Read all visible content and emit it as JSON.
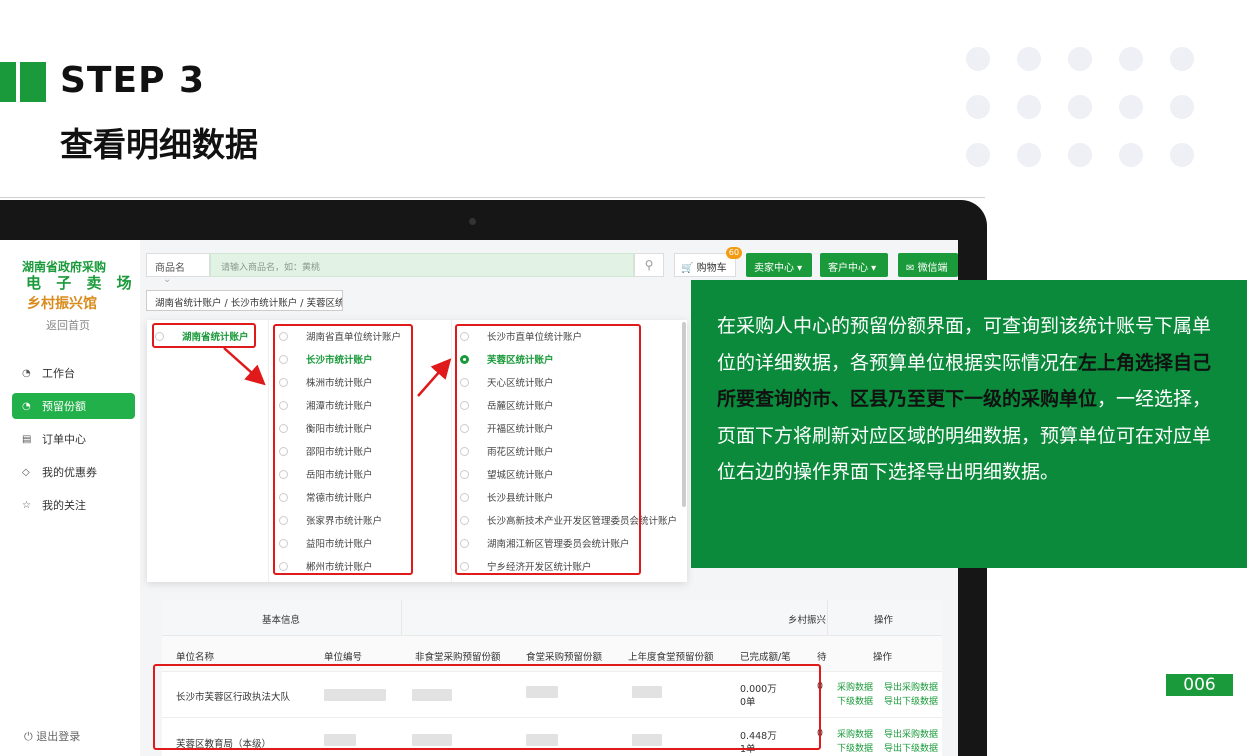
{
  "header": {
    "step": "STEP 3",
    "subtitle": "查看明细数据"
  },
  "app": {
    "logo_line1": "湖南省政府采购",
    "logo_line2": "电 子 卖 场",
    "logo_line3": "乡村振兴馆",
    "home_link": "返回首页",
    "sidebar": [
      {
        "label": "工作台",
        "icon": "clock-icon"
      },
      {
        "label": "预留份额",
        "icon": "clock-icon"
      },
      {
        "label": "订单中心",
        "icon": "document-icon"
      },
      {
        "label": "我的优惠券",
        "icon": "tag-icon"
      },
      {
        "label": "我的关注",
        "icon": "star-icon"
      }
    ],
    "logout": "退出登录",
    "search": {
      "category": "商品名",
      "placeholder": "请输入商品名，如：黄桃"
    },
    "cart": {
      "label": "购物车",
      "count": "60"
    },
    "buttons": {
      "seller": "卖家中心 ▾",
      "customer": "客户中心 ▾",
      "wechat": "微信端"
    },
    "breadcrumb": "湖南省统计账户 / 长沙市统计账户 / 芙蓉区统计账户",
    "cascader": {
      "col1": [
        "湖南省统计账户"
      ],
      "col2": [
        "湖南省直单位统计账户",
        "长沙市统计账户",
        "株洲市统计账户",
        "湘潭市统计账户",
        "衡阳市统计账户",
        "邵阳市统计账户",
        "岳阳市统计账户",
        "常德市统计账户",
        "张家界市统计账户",
        "益阳市统计账户",
        "郴州市统计账户"
      ],
      "col3": [
        "长沙市直单位统计账户",
        "芙蓉区统计账户",
        "天心区统计账户",
        "岳麓区统计账户",
        "开福区统计账户",
        "雨花区统计账户",
        "望城区统计账户",
        "长沙县统计账户",
        "长沙高新技术产业开发区管理委员会统计账户",
        "湖南湘江新区管理委员会统计账户",
        "宁乡经济开发区统计账户"
      ]
    },
    "table": {
      "group_basic": "基本信息",
      "group_rural": "乡村振兴",
      "group_op": "操作",
      "columns": [
        "单位名称",
        "单位编号",
        "非食堂采购预留份额",
        "食堂采购预留份额",
        "上年度食堂预留份额",
        "已完成额/笔",
        "待",
        "操作"
      ],
      "rows": [
        {
          "name": "长沙市芙蓉区行政执法大队",
          "done_amount": "0.000万",
          "done_count": "0单",
          "c": "0",
          "op1": "采购数据",
          "op2": "导出采购数据",
          "op3": "下级数据",
          "op4": "导出下级数据"
        },
        {
          "name": "芙蓉区教育局（本级）",
          "done_amount": "0.448万",
          "done_count": "1单",
          "c": "0",
          "op1": "采购数据",
          "op2": "导出采购数据",
          "op3": "下级数据",
          "op4": "导出下级数据"
        }
      ]
    }
  },
  "info": {
    "text_before": "在采购人中心的预留份额界面，可查询到该统计账号下属单位的详细数据，各预算单位根据实际情况在",
    "text_bold": "左上角选择自己所要查询的市、区县乃至更下一级的采购单位",
    "text_after": "，一经选择，页面下方将刷新对应区域的明细数据，预算单位可在对应单位右边的操作界面下选择导出明细数据。"
  },
  "page_number": "006",
  "colors": {
    "brand_green": "#1a9a3a",
    "info_bg": "#0a8a3a",
    "highlight_red": "#e0191b",
    "accent_orange": "#d98a1a"
  }
}
